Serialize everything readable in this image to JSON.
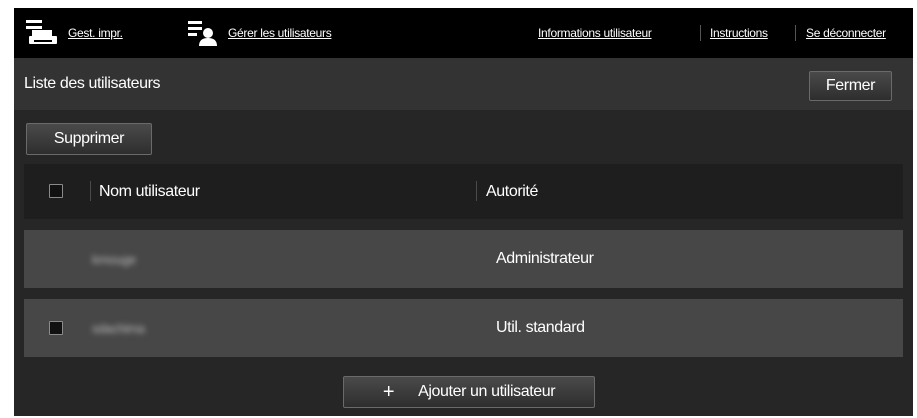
{
  "topbar": {
    "printer_mgmt": "Gest. impr.",
    "manage_users": "Gérer les utilisateurs",
    "user_info": "Informations utilisateur",
    "instructions": "Instructions",
    "logout": "Se déconnecter",
    "icons": [
      "printer-list-icon",
      "user-list-icon"
    ]
  },
  "page": {
    "title": "Liste des utilisateurs",
    "close_label": "Fermer",
    "delete_label": "Supprimer",
    "add_user_label": "Ajouter un utilisateur"
  },
  "table": {
    "columns": [
      "Nom utilisateur",
      "Autorité"
    ],
    "rows": [
      {
        "name": "kmouge",
        "authority": "Administrateur",
        "has_checkbox": false
      },
      {
        "name": "sdachima",
        "authority": "Util. standard",
        "has_checkbox": true
      }
    ]
  },
  "colors": {
    "topbar_bg": "#000000",
    "titlebar_bg": "#333333",
    "content_bg": "#262626",
    "header_bg": "#1e1e1e",
    "row_bg": "#474747"
  }
}
